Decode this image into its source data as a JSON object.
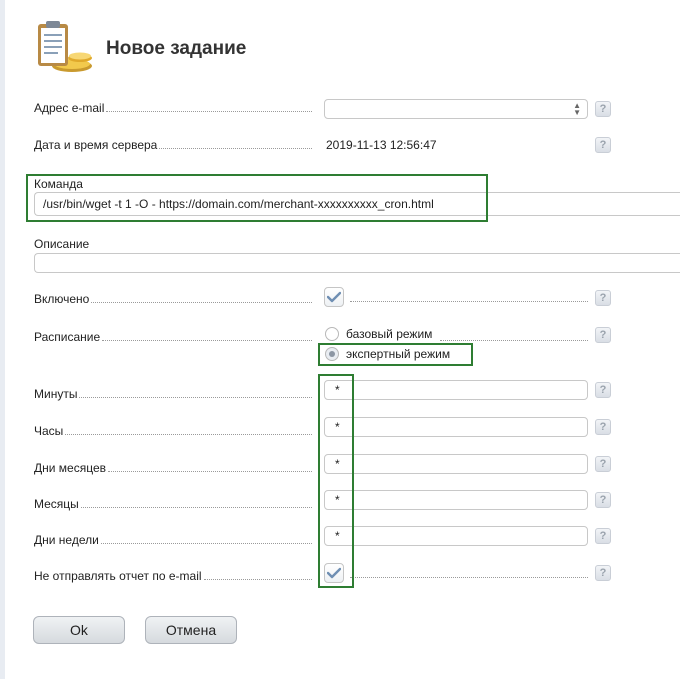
{
  "dialog": {
    "title": "Новое задание",
    "icon": "clipboard-task-icon"
  },
  "fields": {
    "email": {
      "label": "Адрес e-mail",
      "value": ""
    },
    "server_time": {
      "label": "Дата и время сервера",
      "value": "2019-11-13 12:56:47"
    },
    "command": {
      "label": "Команда",
      "value": "/usr/bin/wget -t 1 -O - https://domain.com/merchant-xxxxxxxxxx_cron.html"
    },
    "description": {
      "label": "Описание",
      "value": ""
    },
    "enabled": {
      "label": "Включено",
      "checked": true
    },
    "schedule": {
      "label": "Расписание",
      "options": [
        "базовый режим",
        "экспертный режим"
      ],
      "selected": "экспертный режим"
    },
    "minutes": {
      "label": "Минуты",
      "value": "*"
    },
    "hours": {
      "label": "Часы",
      "value": "*"
    },
    "days_of_month": {
      "label": "Дни месяцев",
      "value": "*"
    },
    "months": {
      "label": "Месяцы",
      "value": "*"
    },
    "weekdays": {
      "label": "Дни недели",
      "value": "*"
    },
    "no_email_report": {
      "label": "Не отправлять отчет по e-mail",
      "checked": true
    }
  },
  "help_label": "?",
  "buttons": {
    "ok": "Ok",
    "cancel": "Отмена"
  },
  "colors": {
    "highlight": "#2e7d32",
    "check": "#6f8fb3"
  }
}
